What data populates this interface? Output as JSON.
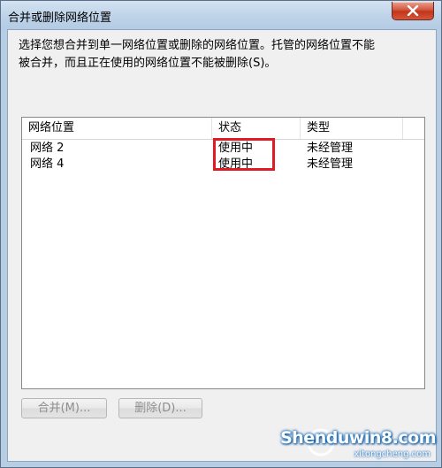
{
  "window": {
    "title": "合并或删除网络位置"
  },
  "description": {
    "line1": "选择您想合并到单一网络位置或删除的网络位置。托管的网络位置不能",
    "line2": "被合并，而且正在使用的网络位置不能被删除(S)。"
  },
  "list": {
    "columns": [
      "网络位置",
      "状态",
      "类型"
    ],
    "rows": [
      {
        "name": "网络  2",
        "status": "使用中",
        "type": "未经管理"
      },
      {
        "name": "网络  4",
        "status": "使用中",
        "type": "未经管理"
      }
    ]
  },
  "buttons": {
    "merge": "合并(M)...",
    "delete": "删除(D)..."
  },
  "watermark": {
    "main": "Shenduwin8.com",
    "sub": "xitongcheng.com"
  },
  "colors": {
    "highlight": "#e01b24",
    "disabled_text": "#8d8d8d"
  }
}
